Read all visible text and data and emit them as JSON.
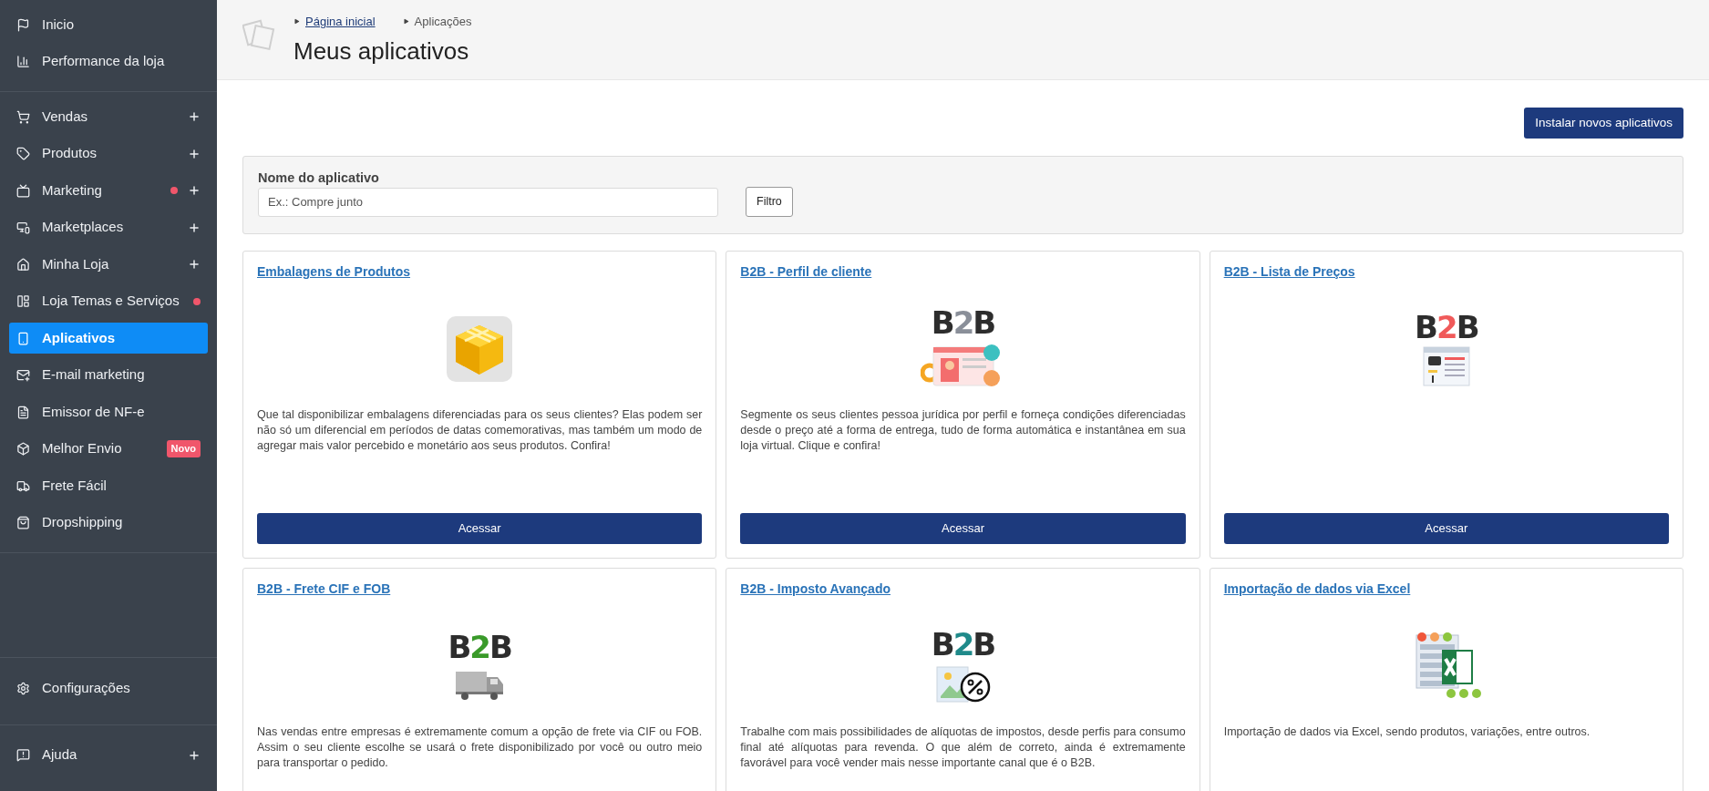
{
  "sidebar": {
    "groups": [
      {
        "items": [
          {
            "label": "Inicio",
            "selected": false,
            "expandable": false,
            "dot": false
          },
          {
            "label": "Performance da loja",
            "selected": false,
            "expandable": false,
            "dot": false
          }
        ]
      },
      {
        "items": [
          {
            "label": "Vendas",
            "selected": false,
            "expandable": true,
            "dot": false
          },
          {
            "label": "Produtos",
            "selected": false,
            "expandable": true,
            "dot": false
          },
          {
            "label": "Marketing",
            "selected": false,
            "expandable": true,
            "dot": true
          },
          {
            "label": "Marketplaces",
            "selected": false,
            "expandable": true,
            "dot": false
          },
          {
            "label": "Minha Loja",
            "selected": false,
            "expandable": true,
            "dot": false
          },
          {
            "label": "Loja Temas e Serviços",
            "selected": false,
            "expandable": false,
            "dot": true
          },
          {
            "label": "Aplicativos",
            "selected": true,
            "expandable": false,
            "dot": false
          },
          {
            "label": "E-mail marketing",
            "selected": false,
            "expandable": false,
            "dot": false
          },
          {
            "label": "Emissor de NF-e",
            "selected": false,
            "expandable": false,
            "dot": false
          },
          {
            "label": "Melhor Envio",
            "selected": false,
            "expandable": false,
            "dot": false,
            "badge": "Novo"
          },
          {
            "label": "Frete Fácil",
            "selected": false,
            "expandable": false,
            "dot": false
          },
          {
            "label": "Dropshipping",
            "selected": false,
            "expandable": false,
            "dot": false
          }
        ]
      }
    ],
    "bottom": [
      {
        "label": "Configurações",
        "selected": false,
        "expandable": false,
        "dot": false
      },
      {
        "label": "Ajuda",
        "selected": false,
        "expandable": true,
        "dot": false
      }
    ]
  },
  "breadcrumbs": [
    {
      "label": "Página inicial",
      "link": true
    },
    {
      "label": "Aplicações",
      "link": false
    }
  ],
  "page_title": "Meus aplicativos",
  "install_button": "Instalar novos aplicativos",
  "filter": {
    "label": "Nome do aplicativo",
    "placeholder": "Ex.: Compre junto",
    "button": "Filtro"
  },
  "apps": [
    {
      "kind": "box",
      "title": "Embalagens de Produtos",
      "description": "Que tal disponibilizar embalagens diferenciadas para os seus clientes? Elas podem ser não só um diferencial em períodos de datas comemorativas, mas também um modo de agregar mais valor percebido e monetário aos seus produtos. Confira!",
      "button": "Acessar"
    },
    {
      "kind": "b2b-profile",
      "logo": "B2B",
      "color": "#8a8f99",
      "title": "B2B - Perfil de cliente",
      "description": "Segmente os seus clientes pessoa jurídica por perfil e forneça condições diferenciadas desde o preço até a forma de entrega, tudo de forma automática e instantânea em sua loja virtual. Clique e confira!",
      "button": "Acessar"
    },
    {
      "kind": "b2b-prices",
      "logo": "B2B",
      "color": "#f05a5a",
      "title": "B2B - Lista de Preços",
      "button": "Acessar"
    },
    {
      "kind": "b2b-truck",
      "logo": "B2B",
      "color": "#3a9a2a",
      "title": "B2B - Frete CIF e FOB",
      "description": "Nas vendas entre empresas é extremamente comum a opção de frete via CIF ou FOB. Assim o seu cliente escolhe se usará o frete disponibilizado por você ou outro meio para transportar o pedido."
    },
    {
      "kind": "b2b-tax",
      "logo": "B2B",
      "color": "#1f8a8a",
      "title": "B2B - Imposto Avançado",
      "description": "Trabalhe com mais possibilidades de alíquotas de impostos, desde perfis para consumo final até alíquotas para revenda. O que além de correto, ainda é extremamente favorável para você vender mais nesse importante canal que é o B2B."
    },
    {
      "kind": "excel",
      "title": "Importação de dados via Excel",
      "description": "Importação de dados via Excel, sendo produtos, variações, entre outros."
    }
  ]
}
